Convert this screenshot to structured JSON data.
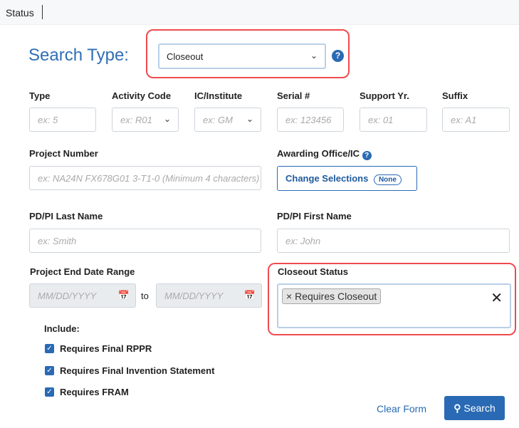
{
  "topbar": {
    "title": "Status"
  },
  "search_type": {
    "label": "Search Type:",
    "value": "Closeout"
  },
  "fields": {
    "type": {
      "label": "Type",
      "placeholder": "ex: 5"
    },
    "activity_code": {
      "label": "Activity Code",
      "placeholder": "ex: R01"
    },
    "ic": {
      "label": "IC/Institute",
      "placeholder": "ex: GM"
    },
    "serial": {
      "label": "Serial #",
      "placeholder": "ex: 123456"
    },
    "support_yr": {
      "label": "Support Yr.",
      "placeholder": "ex: 01"
    },
    "suffix": {
      "label": "Suffix",
      "placeholder": "ex: A1"
    },
    "project_number": {
      "label": "Project Number",
      "placeholder": "ex: NA24N FX678G01 3-T1-0 (Minimum 4 characters)"
    },
    "awarding": {
      "label": "Awarding Office/IC",
      "button": "Change Selections",
      "badge": "None"
    },
    "last_name": {
      "label": "PD/PI Last Name",
      "placeholder": "ex: Smith"
    },
    "first_name": {
      "label": "PD/PI First Name",
      "placeholder": "ex: John"
    },
    "end_date": {
      "label": "Project End Date Range",
      "from_placeholder": "MM/DD/YYYY",
      "to_label": "to",
      "to_placeholder": "MM/DD/YYYY"
    },
    "closeout_status": {
      "label": "Closeout Status",
      "tags": [
        "Requires Closeout"
      ]
    }
  },
  "include": {
    "label": "Include:",
    "items": [
      {
        "label": "Requires Final RPPR",
        "checked": true
      },
      {
        "label": "Requires Final Invention Statement",
        "checked": true
      },
      {
        "label": "Requires FRAM",
        "checked": true
      }
    ]
  },
  "actions": {
    "clear": "Clear Form",
    "search": "Search"
  },
  "colors": {
    "accent": "#2a6ab4",
    "highlight": "#f04a4f"
  }
}
